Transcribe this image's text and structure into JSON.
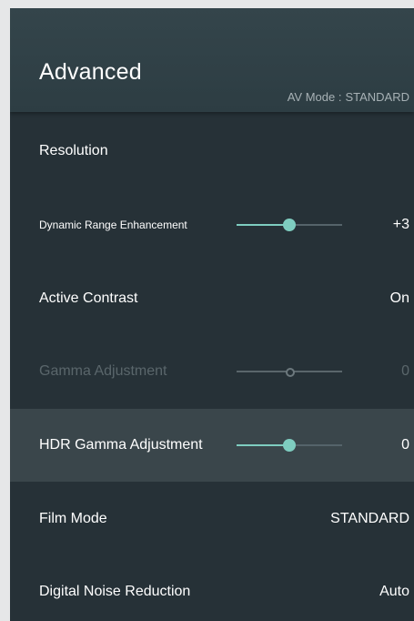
{
  "header": {
    "title": "Advanced",
    "av_mode_label": "AV Mode :",
    "av_mode_value": "STANDARD"
  },
  "menu": {
    "items": [
      {
        "label": "Resolution",
        "value": ""
      },
      {
        "label": "Dynamic Range Enhancement",
        "value": "+3",
        "slider_level": 0.5
      },
      {
        "label": "Active Contrast",
        "value": "On"
      },
      {
        "label": "Gamma Adjustment",
        "value": "0",
        "slider_level": 0.5,
        "disabled": true
      },
      {
        "label": "HDR Gamma Adjustment",
        "value": "0",
        "slider_level": 0.5,
        "selected": true
      },
      {
        "label": "Film Mode",
        "value": "STANDARD"
      },
      {
        "label": "Digital Noise Reduction",
        "value": "Auto"
      }
    ]
  },
  "colors": {
    "accent": "#7ecdc0",
    "panel_background": "#263137",
    "header_background": "#34454b",
    "selected_row": "#3a464b",
    "disabled_text": "#5a666b"
  }
}
